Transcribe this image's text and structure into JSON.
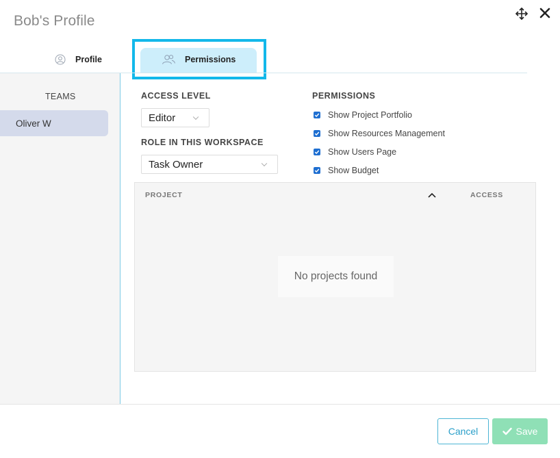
{
  "dialog": {
    "title": "Bob's Profile",
    "move_icon": "move-arrows-icon",
    "close_icon": "close-icon"
  },
  "tabs": [
    {
      "label": "Profile",
      "icon": "user-circle-icon",
      "active": false
    },
    {
      "label": "Permissions",
      "icon": "users-icon",
      "active": true
    }
  ],
  "sidebar": {
    "heading": "TEAMS",
    "items": [
      {
        "label": "Oliver W",
        "selected": true
      }
    ]
  },
  "form": {
    "access_level": {
      "label": "ACCESS LEVEL",
      "value": "Editor"
    },
    "role": {
      "label": "ROLE IN THIS WORKSPACE",
      "value": "Task Owner"
    }
  },
  "permissions": {
    "heading": "PERMISSIONS",
    "items": [
      {
        "label": "Show Project Portfolio",
        "checked": true
      },
      {
        "label": "Show Resources Management",
        "checked": true
      },
      {
        "label": "Show Users Page",
        "checked": true
      },
      {
        "label": "Show Budget",
        "checked": true
      }
    ]
  },
  "table": {
    "columns": [
      "PROJECT",
      "ACCESS"
    ],
    "sort_icon": "chevron-up-icon",
    "empty_text": "No projects found"
  },
  "footer": {
    "cancel_label": "Cancel",
    "save_label": "Save",
    "save_icon": "checkmark-icon"
  },
  "colors": {
    "accent": "#13b8ea",
    "tab_active_bg": "#cdeefb",
    "sidebar_selected_bg": "#d4daeb",
    "checkbox": "#1f6fd1",
    "save_bg": "#8fe0b6",
    "cancel_border": "#4bb4d4"
  }
}
